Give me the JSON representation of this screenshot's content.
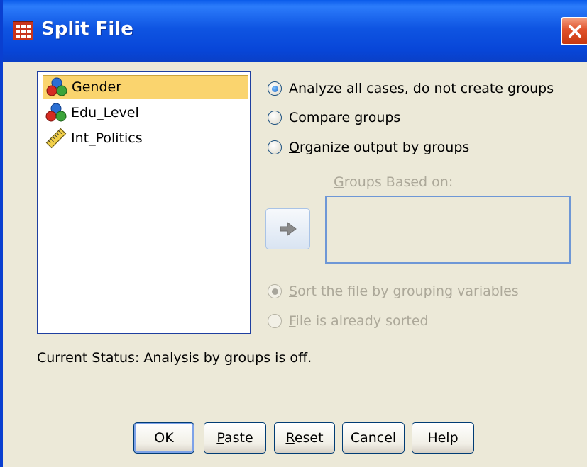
{
  "window": {
    "title": "Split File",
    "close_glyph": "✕"
  },
  "variables": [
    {
      "label": "Gender",
      "icon": "nominal-variable-icon",
      "selected": true
    },
    {
      "label": "Edu_Level",
      "icon": "nominal-variable-icon",
      "selected": false
    },
    {
      "label": "Int_Politics",
      "icon": "scale-variable-icon",
      "selected": false
    }
  ],
  "mode_options": [
    {
      "key": "A",
      "rest": "nalyze all cases, do not create groups",
      "checked": true
    },
    {
      "key": "C",
      "rest": "ompare groups",
      "checked": false
    },
    {
      "key": "O",
      "rest": "rganize output by groups",
      "checked": false
    }
  ],
  "groups_based_on": {
    "key": "G",
    "rest": "roups Based on:",
    "items": []
  },
  "sort_options": [
    {
      "key": "S",
      "rest": "ort the file by grouping variables",
      "checked": true,
      "disabled": true
    },
    {
      "key": "F",
      "rest": "ile is already sorted",
      "checked": false,
      "disabled": true
    }
  ],
  "status_text": "Current Status: Analysis by groups is off.",
  "buttons": {
    "ok": {
      "label": "OK"
    },
    "paste": {
      "key": "P",
      "rest": "aste"
    },
    "reset": {
      "key": "R",
      "rest": "eset"
    },
    "cancel": {
      "label": "Cancel"
    },
    "help": {
      "label": "Help"
    }
  },
  "colors": {
    "titlebar": "#0A5BEA",
    "selection": "#FAD46E",
    "dialog_bg": "#ECE9D8",
    "list_border": "#1F3FA0"
  }
}
